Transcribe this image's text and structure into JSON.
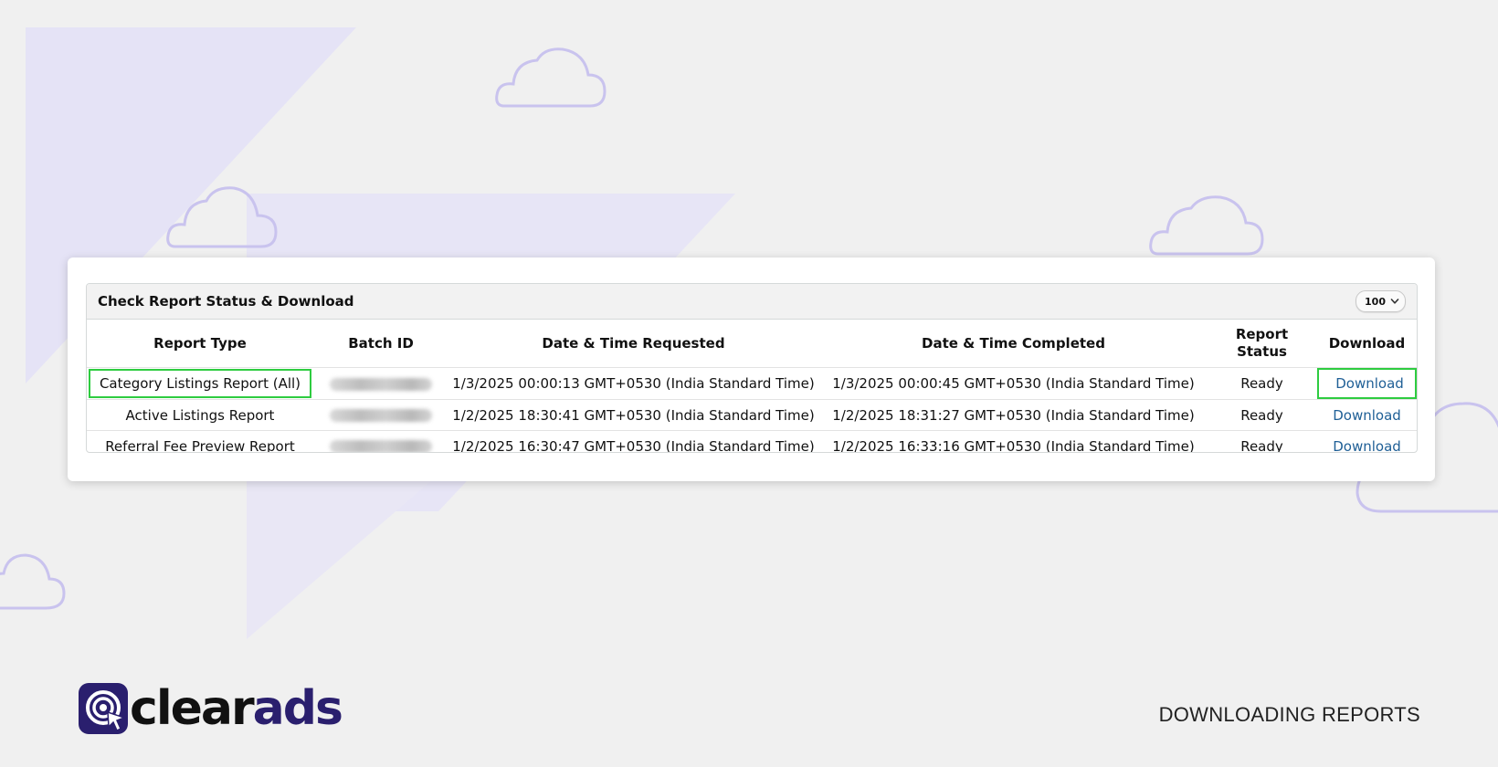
{
  "panel": {
    "title": "Check Report Status & Download",
    "page_size": "100"
  },
  "table": {
    "headers": {
      "report_type": "Report Type",
      "batch_id": "Batch ID",
      "requested": "Date & Time Requested",
      "completed": "Date & Time Completed",
      "status": "Report Status",
      "download": "Download"
    },
    "rows": [
      {
        "report_type": "Category Listings Report (All)",
        "requested": "1/3/2025 00:00:13 GMT+0530 (India Standard Time)",
        "completed": "1/3/2025 00:00:45 GMT+0530 (India Standard Time)",
        "status": "Ready",
        "download": "Download",
        "highlighted": true
      },
      {
        "report_type": "Active Listings Report",
        "requested": "1/2/2025 18:30:41 GMT+0530 (India Standard Time)",
        "completed": "1/2/2025 18:31:27 GMT+0530 (India Standard Time)",
        "status": "Ready",
        "download": "Download",
        "highlighted": false
      },
      {
        "report_type": "Referral Fee Preview Report",
        "requested": "1/2/2025 16:30:47 GMT+0530 (India Standard Time)",
        "completed": "1/2/2025 16:33:16 GMT+0530 (India Standard Time)",
        "status": "Ready",
        "download": "Download",
        "highlighted": false
      }
    ]
  },
  "brand": {
    "logo_text_clear": "clear",
    "logo_text_ads": "ads",
    "caption": "DOWNLOADING REPORTS"
  },
  "colors": {
    "background": "#f0f0f0",
    "highlight_green": "#2ecc40",
    "link_blue": "#1f5f96",
    "brand_navy": "#2a1f6e",
    "decor_lavender": "#c9c3ee"
  },
  "icons": {
    "page_size_select": "chevron-down-icon",
    "logo": "at-cursor-logo-icon"
  }
}
